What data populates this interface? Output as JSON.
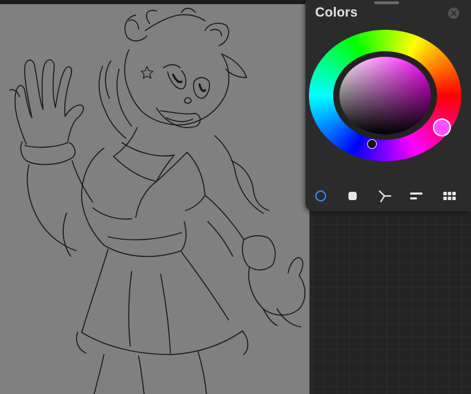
{
  "panel": {
    "title": "Colors",
    "hue_color": "#ff4dff",
    "accent": "#2f86f5",
    "modes": [
      {
        "name": "disc",
        "icon": "disc-mode-icon",
        "active": true
      },
      {
        "name": "classic",
        "icon": "classic-mode-icon",
        "active": false
      },
      {
        "name": "harmony",
        "icon": "harmony-mode-icon",
        "active": false
      },
      {
        "name": "value",
        "icon": "value-sliders-icon",
        "active": false
      },
      {
        "name": "palettes",
        "icon": "palettes-grid-icon",
        "active": false
      }
    ]
  }
}
